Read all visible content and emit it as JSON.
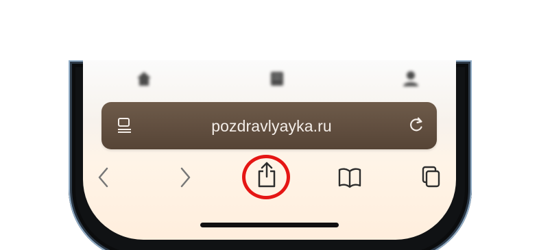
{
  "browser": {
    "address_bar": {
      "url": "pozdravlyayka.ru",
      "reader_icon": "reader-mode-icon",
      "reload_icon": "reload-icon"
    },
    "page_nav_icons": [
      "home-icon",
      "book-icon",
      "profile-icon"
    ],
    "toolbar_icons": [
      "back-arrow-icon",
      "forward-arrow-icon",
      "share-icon",
      "bookmarks-icon",
      "tabs-icon"
    ]
  },
  "colors": {
    "address_bar": "#5f4c3d",
    "highlight": "#e51614",
    "phone_accent": "#92aec8",
    "toolbar_icon": "#2d2d2d"
  }
}
